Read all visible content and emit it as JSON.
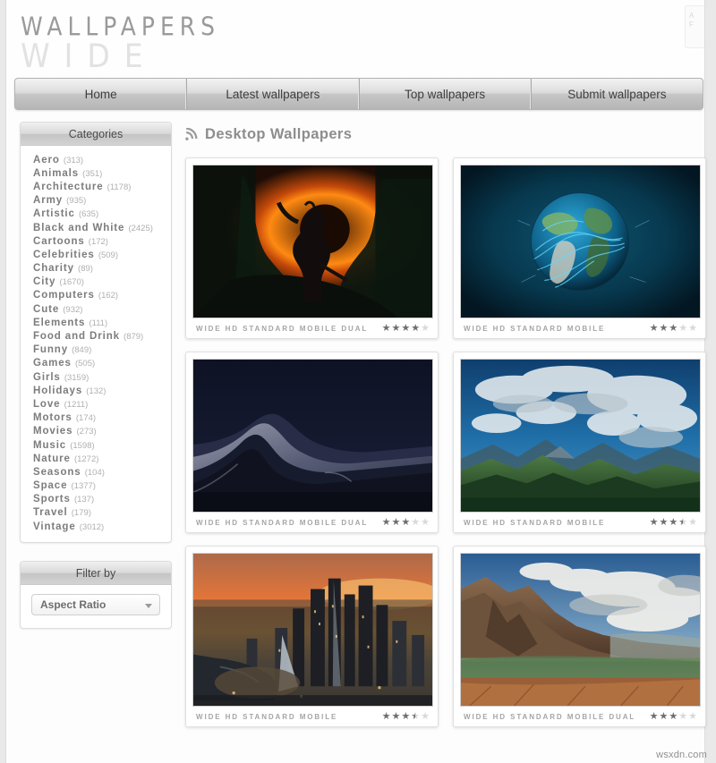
{
  "site": {
    "logo_line1": "WALLPAPERS",
    "logo_line2": "WIDE",
    "corner_line1": "A",
    "corner_line2": "F",
    "watermark": "wsxdn.com"
  },
  "nav": {
    "items": [
      {
        "label": "Home"
      },
      {
        "label": "Latest wallpapers"
      },
      {
        "label": "Top wallpapers"
      },
      {
        "label": "Submit wallpapers"
      }
    ]
  },
  "sidebar": {
    "categories_title": "Categories",
    "categories": [
      {
        "name": "Aero",
        "count": "(313)"
      },
      {
        "name": "Animals",
        "count": "(351)"
      },
      {
        "name": "Architecture",
        "count": "(1178)"
      },
      {
        "name": "Army",
        "count": "(935)"
      },
      {
        "name": "Artistic",
        "count": "(635)"
      },
      {
        "name": "Black and White",
        "count": "(2425)"
      },
      {
        "name": "Cartoons",
        "count": "(172)"
      },
      {
        "name": "Celebrities",
        "count": "(509)"
      },
      {
        "name": "Charity",
        "count": "(89)"
      },
      {
        "name": "City",
        "count": "(1670)"
      },
      {
        "name": "Computers",
        "count": "(162)"
      },
      {
        "name": "Cute",
        "count": "(932)"
      },
      {
        "name": "Elements",
        "count": "(111)"
      },
      {
        "name": "Food and Drink",
        "count": "(879)"
      },
      {
        "name": "Funny",
        "count": "(849)"
      },
      {
        "name": "Games",
        "count": "(505)"
      },
      {
        "name": "Girls",
        "count": "(3159)"
      },
      {
        "name": "Holidays",
        "count": "(132)"
      },
      {
        "name": "Love",
        "count": "(1211)"
      },
      {
        "name": "Motors",
        "count": "(174)"
      },
      {
        "name": "Movies",
        "count": "(273)"
      },
      {
        "name": "Music",
        "count": "(1598)"
      },
      {
        "name": "Nature",
        "count": "(1272)"
      },
      {
        "name": "Seasons",
        "count": "(104)"
      },
      {
        "name": "Space",
        "count": "(1377)"
      },
      {
        "name": "Sports",
        "count": "(137)"
      },
      {
        "name": "Travel",
        "count": "(179)"
      },
      {
        "name": "Vintage",
        "count": "(3012)"
      }
    ],
    "filter_title": "Filter by",
    "filter_select_value": "Aspect Ratio"
  },
  "main": {
    "heading": "Desktop Wallpapers",
    "heading_icon": "rss-icon",
    "cards": [
      {
        "formats": "WIDE HD STANDARD MOBILE DUAL",
        "rating": 4,
        "scene": "eclipse-jungle-warrior"
      },
      {
        "formats": "WIDE HD STANDARD MOBILE",
        "rating": 3,
        "scene": "blue-earth-globe"
      },
      {
        "formats": "WIDE HD STANDARD MOBILE DUAL",
        "rating": 3,
        "scene": "night-desert-dunes"
      },
      {
        "formats": "WIDE HD STANDARD MOBILE",
        "rating": 3.5,
        "scene": "green-mountains-clouds"
      },
      {
        "formats": "WIDE HD STANDARD MOBILE",
        "rating": 3.5,
        "scene": "city-skyline-sunset"
      },
      {
        "formats": "WIDE HD STANDARD MOBILE DUAL",
        "rating": 3,
        "scene": "mountain-lake-valley"
      }
    ]
  }
}
